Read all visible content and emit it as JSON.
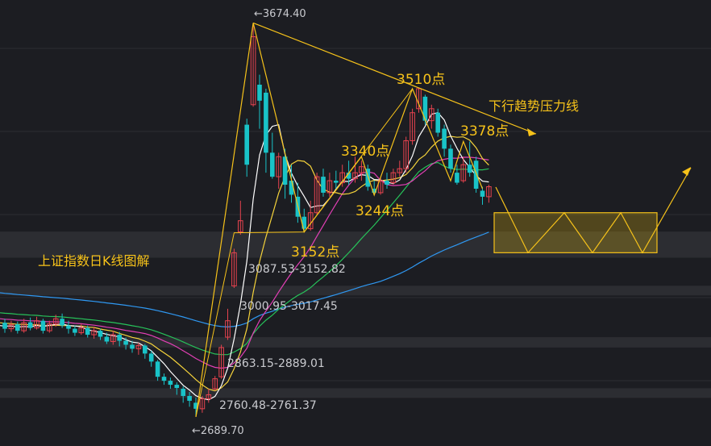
{
  "chart_data": {
    "type": "candlestick",
    "title": "上证指数日K线图解",
    "grid": true,
    "colors": {
      "background": "#1c1d22",
      "up": "#e8434f",
      "down": "#19c3c8",
      "ma5": "#ffffff",
      "ma10": "#f5d33b",
      "ma20": "#e23fb5",
      "ma30": "#27c35a",
      "ma60": "#2f98f2",
      "annotation": "#f6c21a",
      "gap_band": "#3a3b40"
    },
    "extremes": {
      "high_label": "←3674.40",
      "low_label": "←2689.70"
    },
    "gap_zones": [
      {
        "label": "3087.53-3152.82",
        "range": [
          3087.53,
          3152.82
        ]
      },
      {
        "label": "3000.95-3017.45",
        "range": [
          3000.95,
          3017.45
        ]
      },
      {
        "label": "2863.15-2889.01",
        "range": [
          2863.15,
          2889.01
        ]
      },
      {
        "label": "2760.48-2761.37",
        "range": [
          2760.48,
          2761.37
        ]
      }
    ],
    "points": [
      {
        "label": "3510点",
        "value": 3510
      },
      {
        "label": "3340点",
        "value": 3340
      },
      {
        "label": "3378点",
        "value": 3378
      },
      {
        "label": "3244点",
        "value": 3244
      },
      {
        "label": "3152点",
        "value": 3152
      }
    ],
    "trend_label": "下行趋势压力线",
    "consolidation_box": [
      3100,
      3200
    ],
    "candles": [
      {
        "o": 2925,
        "c": 2910,
        "h": 2935,
        "l": 2900
      },
      {
        "o": 2910,
        "c": 2920,
        "h": 2930,
        "l": 2902
      },
      {
        "o": 2921,
        "c": 2905,
        "h": 2928,
        "l": 2898
      },
      {
        "o": 2905,
        "c": 2925,
        "h": 2935,
        "l": 2900
      },
      {
        "o": 2926,
        "c": 2912,
        "h": 2938,
        "l": 2906
      },
      {
        "o": 2912,
        "c": 2930,
        "h": 2940,
        "l": 2908
      },
      {
        "o": 2930,
        "c": 2905,
        "h": 2935,
        "l": 2898
      },
      {
        "o": 2905,
        "c": 2922,
        "h": 2930,
        "l": 2900
      },
      {
        "o": 2922,
        "c": 2935,
        "h": 2945,
        "l": 2915
      },
      {
        "o": 2935,
        "c": 2918,
        "h": 2948,
        "l": 2912
      },
      {
        "o": 2918,
        "c": 2910,
        "h": 2930,
        "l": 2898
      },
      {
        "o": 2910,
        "c": 2900,
        "h": 2918,
        "l": 2892
      },
      {
        "o": 2900,
        "c": 2912,
        "h": 2922,
        "l": 2895
      },
      {
        "o": 2912,
        "c": 2895,
        "h": 2918,
        "l": 2888
      },
      {
        "o": 2895,
        "c": 2905,
        "h": 2915,
        "l": 2885
      },
      {
        "o": 2905,
        "c": 2890,
        "h": 2910,
        "l": 2882
      },
      {
        "o": 2890,
        "c": 2878,
        "h": 2900,
        "l": 2872
      },
      {
        "o": 2878,
        "c": 2895,
        "h": 2905,
        "l": 2870
      },
      {
        "o": 2895,
        "c": 2880,
        "h": 2902,
        "l": 2866
      },
      {
        "o": 2880,
        "c": 2870,
        "h": 2888,
        "l": 2858
      },
      {
        "o": 2870,
        "c": 2860,
        "h": 2880,
        "l": 2850
      },
      {
        "o": 2860,
        "c": 2868,
        "h": 2875,
        "l": 2845
      },
      {
        "o": 2868,
        "c": 2848,
        "h": 2872,
        "l": 2835
      },
      {
        "o": 2848,
        "c": 2828,
        "h": 2855,
        "l": 2815
      },
      {
        "o": 2828,
        "c": 2790,
        "h": 2832,
        "l": 2780
      },
      {
        "o": 2790,
        "c": 2780,
        "h": 2798,
        "l": 2770
      },
      {
        "o": 2780,
        "c": 2770,
        "h": 2788,
        "l": 2760
      },
      {
        "o": 2770,
        "c": 2762,
        "h": 2776,
        "l": 2745
      },
      {
        "o": 2760,
        "c": 2742,
        "h": 2766,
        "l": 2725
      },
      {
        "o": 2742,
        "c": 2730,
        "h": 2752,
        "l": 2715
      },
      {
        "o": 2725,
        "c": 2710,
        "h": 2738,
        "l": 2690
      },
      {
        "o": 2710,
        "c": 2735,
        "h": 2742,
        "l": 2700
      },
      {
        "o": 2735,
        "c": 2745,
        "h": 2760,
        "l": 2725
      },
      {
        "o": 2760,
        "c": 2785,
        "h": 2792,
        "l": 2755
      },
      {
        "o": 2790,
        "c": 2863,
        "h": 2870,
        "l": 2785
      },
      {
        "o": 2889,
        "c": 2930,
        "h": 2960,
        "l": 2882
      },
      {
        "o": 3017,
        "c": 3100,
        "h": 3110,
        "l": 3012
      },
      {
        "o": 3152,
        "c": 3180,
        "h": 3230,
        "l": 3145
      },
      {
        "o": 3420,
        "c": 3320,
        "h": 3435,
        "l": 3290
      },
      {
        "o": 3470,
        "c": 3640,
        "h": 3674,
        "l": 3465
      },
      {
        "o": 3520,
        "c": 3480,
        "h": 3545,
        "l": 3410
      },
      {
        "o": 3500,
        "c": 3350,
        "h": 3510,
        "l": 3300
      },
      {
        "o": 3350,
        "c": 3290,
        "h": 3400,
        "l": 3285
      },
      {
        "o": 3290,
        "c": 3340,
        "h": 3350,
        "l": 3260
      },
      {
        "o": 3340,
        "c": 3270,
        "h": 3360,
        "l": 3235
      },
      {
        "o": 3280,
        "c": 3245,
        "h": 3320,
        "l": 3225
      },
      {
        "o": 3240,
        "c": 3190,
        "h": 3275,
        "l": 3175
      },
      {
        "o": 3190,
        "c": 3160,
        "h": 3210,
        "l": 3152
      },
      {
        "o": 3160,
        "c": 3200,
        "h": 3230,
        "l": 3155
      },
      {
        "o": 3200,
        "c": 3290,
        "h": 3300,
        "l": 3195
      },
      {
        "o": 3290,
        "c": 3250,
        "h": 3310,
        "l": 3240
      },
      {
        "o": 3250,
        "c": 3280,
        "h": 3300,
        "l": 3240
      },
      {
        "o": 3280,
        "c": 3275,
        "h": 3305,
        "l": 3260
      },
      {
        "o": 3275,
        "c": 3300,
        "h": 3320,
        "l": 3265
      },
      {
        "o": 3300,
        "c": 3285,
        "h": 3330,
        "l": 3270
      },
      {
        "o": 3285,
        "c": 3300,
        "h": 3340,
        "l": 3275
      },
      {
        "o": 3300,
        "c": 3315,
        "h": 3330,
        "l": 3280
      },
      {
        "o": 3310,
        "c": 3265,
        "h": 3320,
        "l": 3255
      },
      {
        "o": 3260,
        "c": 3250,
        "h": 3280,
        "l": 3244
      },
      {
        "o": 3250,
        "c": 3280,
        "h": 3290,
        "l": 3245
      },
      {
        "o": 3280,
        "c": 3270,
        "h": 3300,
        "l": 3260
      },
      {
        "o": 3275,
        "c": 3300,
        "h": 3310,
        "l": 3270
      },
      {
        "o": 3300,
        "c": 3310,
        "h": 3330,
        "l": 3290
      },
      {
        "o": 3310,
        "c": 3380,
        "h": 3390,
        "l": 3300
      },
      {
        "o": 3380,
        "c": 3450,
        "h": 3460,
        "l": 3370
      },
      {
        "o": 3460,
        "c": 3510,
        "h": 3510,
        "l": 3450
      },
      {
        "o": 3490,
        "c": 3430,
        "h": 3495,
        "l": 3420
      },
      {
        "o": 3430,
        "c": 3460,
        "h": 3470,
        "l": 3410
      },
      {
        "o": 3450,
        "c": 3400,
        "h": 3460,
        "l": 3390
      },
      {
        "o": 3410,
        "c": 3360,
        "h": 3420,
        "l": 3340
      },
      {
        "o": 3360,
        "c": 3310,
        "h": 3370,
        "l": 3300
      },
      {
        "o": 3300,
        "c": 3275,
        "h": 3320,
        "l": 3270
      },
      {
        "o": 3280,
        "c": 3320,
        "h": 3340,
        "l": 3275
      },
      {
        "o": 3320,
        "c": 3300,
        "h": 3378,
        "l": 3290
      },
      {
        "o": 3330,
        "c": 3260,
        "h": 3340,
        "l": 3250
      },
      {
        "o": 3255,
        "c": 3240,
        "h": 3265,
        "l": 3220
      },
      {
        "o": 3240,
        "c": 3265,
        "h": 3270,
        "l": 3225
      }
    ]
  }
}
